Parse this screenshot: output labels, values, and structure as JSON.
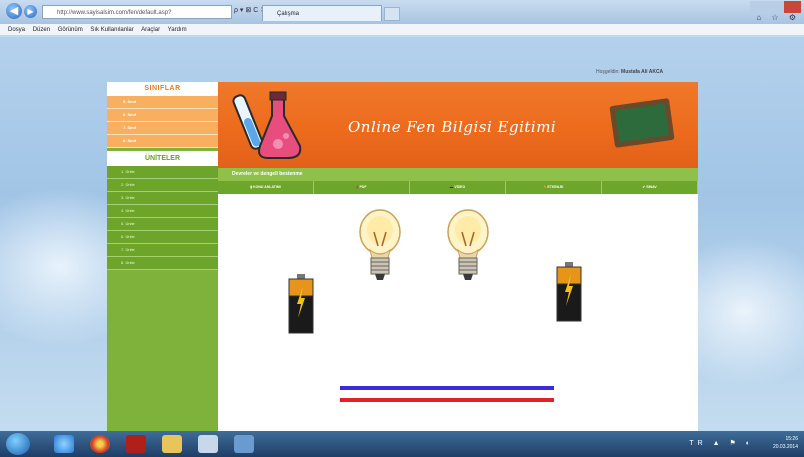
{
  "browser": {
    "address": "http://www.sayisalsim.com/fen/default.asp?",
    "address_icons": "ρ ▾ ⊠ C ✕",
    "tab_title": "Çalışma",
    "menu": [
      "Dosya",
      "Düzen",
      "Görünüm",
      "Sık Kullanılanlar",
      "Araçlar",
      "Yardım"
    ],
    "back_glyph": "◀",
    "forward_glyph": "▶",
    "tools_glyphs": "⌂ ☆ ⚙"
  },
  "site": {
    "welcome_prefix": "Hoşgeldin:",
    "welcome_name": "Mustafa Ali AKCA",
    "classes_title": "SINIFLAR",
    "classes": [
      "5. Sınıf",
      "6. Sınıf",
      "7. Sınıf",
      "8. Sınıf"
    ],
    "units_title": "ÜNİTELER",
    "units": [
      "1. Ünite",
      "2. Ünite",
      "3. Ünite",
      "4. Ünite",
      "5. Ünite",
      "6. Ünite",
      "7. Ünite",
      "8. Ünite"
    ],
    "banner_title": "Online Fen Bilgisi Egitimi",
    "topic_title": "Devreler ve dengeli bestenme",
    "tabs": [
      "KONU ANLATIMI",
      "PDF",
      "VİDEO",
      "ETKİNLİK",
      "SINAV"
    ]
  },
  "taskbar": {
    "time": "15:26",
    "date": "20.03.2014",
    "tray_glyphs": "TR ▲ ⚑ ◐"
  },
  "colors": {
    "orange": "#ec6a1c",
    "green": "#7fb23a",
    "wire_blue": "#3a2ad8",
    "wire_red": "#e0202a"
  }
}
